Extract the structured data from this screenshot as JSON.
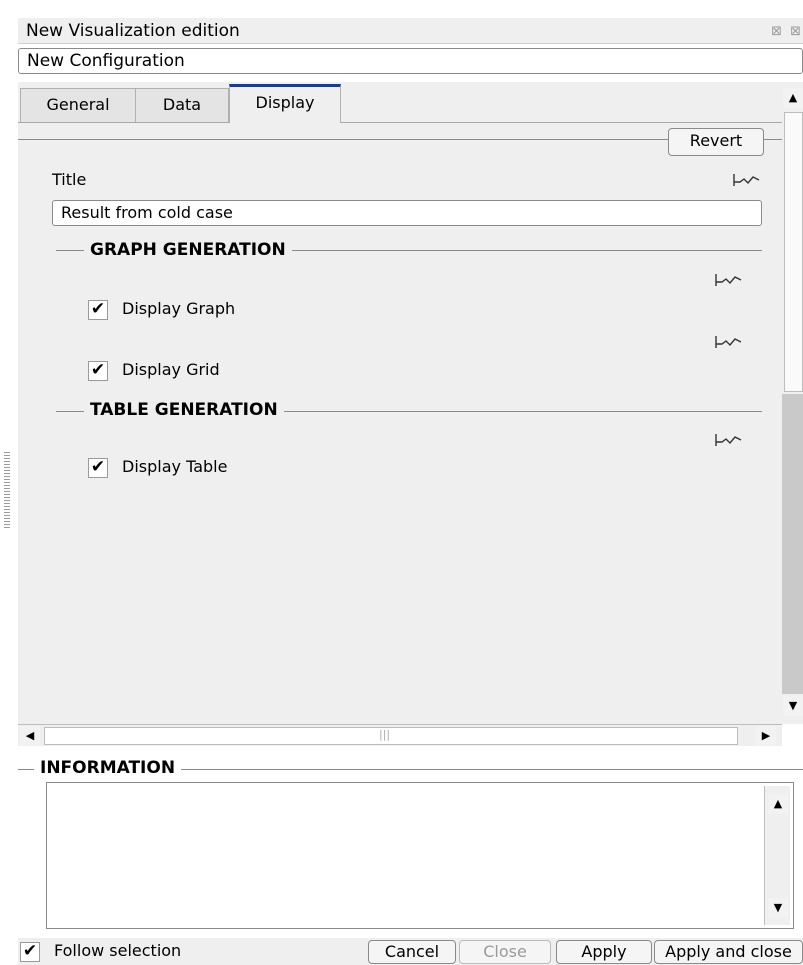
{
  "window": {
    "title": "New Visualization edition"
  },
  "config": {
    "value": "New Configuration"
  },
  "tabs": [
    {
      "label": "General"
    },
    {
      "label": "Data"
    },
    {
      "label": "Display"
    }
  ],
  "revert_label": "Revert",
  "title_field": {
    "label": "Title",
    "value": "Result from cold case"
  },
  "sections": {
    "graph": {
      "title": "GRAPH GENERATION",
      "display_graph": "Display Graph",
      "display_grid": "Display Grid"
    },
    "table": {
      "title": "TABLE GENERATION",
      "display_table": "Display Table"
    }
  },
  "checkboxes": {
    "display_graph": true,
    "display_grid": true,
    "display_table": true,
    "follow_selection": true
  },
  "information": {
    "title": "INFORMATION"
  },
  "footer": {
    "follow_selection": "Follow selection",
    "cancel": "Cancel",
    "close": "Close",
    "apply": "Apply",
    "apply_and_close": "Apply and close"
  },
  "icons": {
    "checkmark": "✔",
    "curve": "curve-icon"
  }
}
